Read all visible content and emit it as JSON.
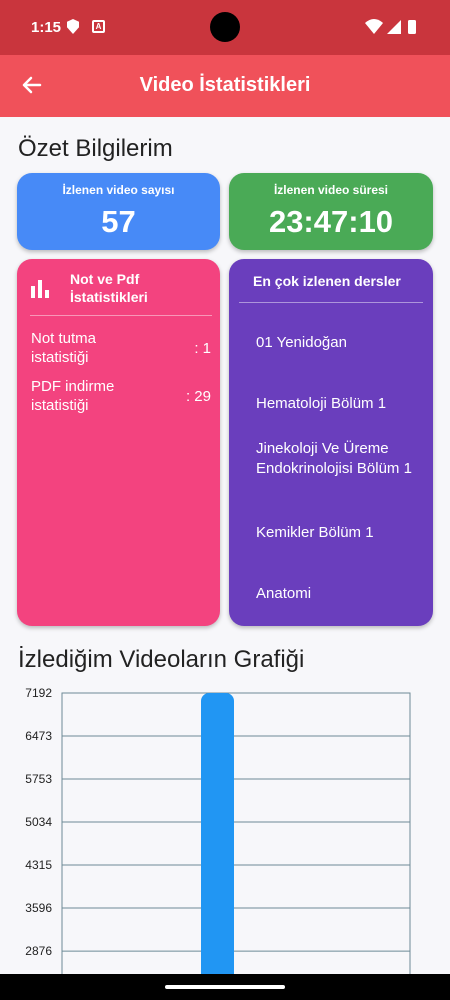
{
  "status": {
    "time": "1:15"
  },
  "app_bar": {
    "title": "Video İstatistikleri"
  },
  "summary": {
    "title": "Özet Bilgilerim",
    "watched_count": {
      "label": "İzlenen video sayısı",
      "value": "57"
    },
    "watched_time": {
      "label": "İzlenen video süresi",
      "value": "23:47:10"
    }
  },
  "notes_card": {
    "title": "Not ve Pdf İstatistikleri",
    "rows": [
      {
        "label": "Not tutma istatistiği",
        "value": ": 1"
      },
      {
        "label": "PDF indirme istatistiği",
        "value": ": 29"
      }
    ]
  },
  "top_lessons": {
    "title": "En çok izlenen dersler",
    "items": [
      "01 Yenidoğan",
      "Hematoloji Bölüm 1",
      "Jinekoloji Ve Üreme Endokrinolojisi Bölüm 1",
      "Kemikler Bölüm 1",
      "Anatomi"
    ]
  },
  "chart_section": {
    "title": "İzlediğim Videoların Grafiği"
  },
  "colors": {
    "status_bar": "#c9353d",
    "app_bar": "#f0515a",
    "blue": "#478af7",
    "green": "#4aaa56",
    "pink": "#f3437f",
    "purple": "#6a3ebd",
    "bar": "#2196f3"
  },
  "chart_data": {
    "type": "bar",
    "title": "",
    "xlabel": "",
    "ylabel": "",
    "y_ticks": [
      7192,
      6473,
      5753,
      5034,
      4315,
      3596,
      2876
    ],
    "ylim_visible": [
      2876,
      7192
    ],
    "categories": [
      ""
    ],
    "values": [
      7192
    ],
    "grid": true,
    "legend": "none"
  }
}
